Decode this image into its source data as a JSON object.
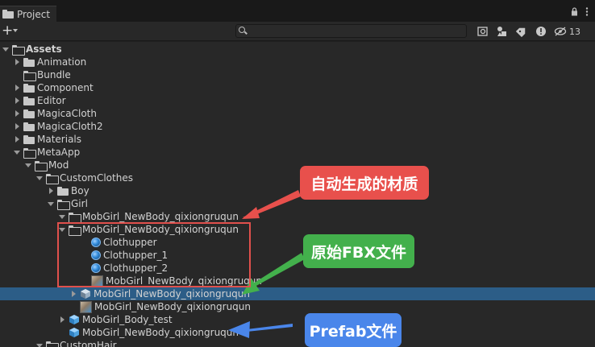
{
  "window": {
    "tab_label": "Project",
    "lock_icon": "lock-icon",
    "menu_icon": "kebab-menu-icon"
  },
  "toolbar": {
    "create_label": "+",
    "search_placeholder": "",
    "hidden_count": "13"
  },
  "tree": {
    "rows": [
      {
        "label": "Assets",
        "arrow": "down",
        "icon": "folder-open",
        "bold": true
      },
      {
        "label": "Animation",
        "arrow": "right",
        "icon": "folder"
      },
      {
        "label": "Bundle",
        "arrow": "none",
        "icon": "folder-empty"
      },
      {
        "label": "Component",
        "arrow": "right",
        "icon": "folder"
      },
      {
        "label": "Editor",
        "arrow": "right",
        "icon": "folder"
      },
      {
        "label": "MagicaCloth",
        "arrow": "right",
        "icon": "folder"
      },
      {
        "label": "MagicaCloth2",
        "arrow": "right",
        "icon": "folder"
      },
      {
        "label": "Materials",
        "arrow": "right",
        "icon": "folder"
      },
      {
        "label": "MetaApp",
        "arrow": "down",
        "icon": "folder-open"
      },
      {
        "label": "Mod",
        "arrow": "down",
        "icon": "folder-open"
      },
      {
        "label": "CustomClothes",
        "arrow": "down",
        "icon": "folder-open"
      },
      {
        "label": "Boy",
        "arrow": "right",
        "icon": "folder"
      },
      {
        "label": "Girl",
        "arrow": "down",
        "icon": "folder-open"
      },
      {
        "label": "MobGirl_NewBody_qixiongruqun",
        "arrow": "down",
        "icon": "folder-open"
      },
      {
        "label": "MobGirl_NewBody_qixiongruqun",
        "arrow": "down",
        "icon": "folder-open"
      },
      {
        "label": "Clothupper",
        "arrow": "none",
        "icon": "material"
      },
      {
        "label": "Clothupper_1",
        "arrow": "none",
        "icon": "material"
      },
      {
        "label": "Clothupper_2",
        "arrow": "none",
        "icon": "material"
      },
      {
        "label": "MobGirl_NewBody_qixiongruqun",
        "arrow": "none",
        "icon": "texture"
      },
      {
        "label": "MobGirl_NewBody_qixiongruqun",
        "arrow": "right",
        "icon": "model",
        "selected": true
      },
      {
        "label": "MobGirl_NewBody_qixiongruqun",
        "arrow": "none",
        "icon": "texture"
      },
      {
        "label": "MobGirl_Body_test",
        "arrow": "right",
        "icon": "prefab"
      },
      {
        "label": "MobGirl_NewBody_qixiongruqun",
        "arrow": "none",
        "icon": "prefab"
      },
      {
        "label": "CustomHair",
        "arrow": "down",
        "icon": "folder-open"
      }
    ]
  },
  "annotations": {
    "material_label": "自动生成的材质",
    "fbx_label": "原始FBX文件",
    "prefab_label": "Prefab文件",
    "colors": {
      "red": "#e8504c",
      "green": "#43b04c",
      "blue": "#4a86ea"
    }
  }
}
